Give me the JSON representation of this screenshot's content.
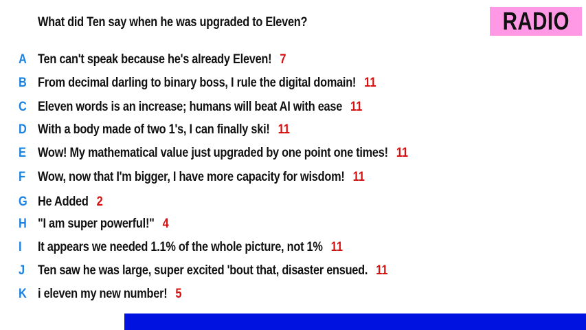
{
  "question": "What did Ten say when he was upgraded to Eleven?",
  "badge": {
    "label": "RADIO",
    "color": "#ff99e6"
  },
  "colors": {
    "letter": "#1a82e2",
    "count": "#d41010",
    "bar": "#0012e0"
  },
  "answers": [
    {
      "letter": "A",
      "text": "Ten can't speak because he's already Eleven!",
      "count": "7"
    },
    {
      "letter": "B",
      "text": "From decimal darling to binary boss, I rule the digital domain!",
      "count": "11"
    },
    {
      "letter": "C",
      "text": "Eleven words is an increase; humans will beat AI with ease",
      "count": "11"
    },
    {
      "letter": "D",
      "text": "With a body made of two 1's, I can finally ski!",
      "count": "11"
    },
    {
      "letter": "E",
      "text": "Wow! My mathematical value just upgraded by one point one times!",
      "count": "11"
    },
    {
      "letter": "F",
      "text": "Wow, now that I'm bigger, I have more capacity for wisdom!",
      "count": "11"
    },
    {
      "letter": "G",
      "text": "He Added",
      "count": "2"
    },
    {
      "letter": "H",
      "text": "\"I am super powerful!\"",
      "count": "4"
    },
    {
      "letter": "I",
      "text": "It appears we needed 1.1% of the whole picture, not 1%",
      "count": "11"
    },
    {
      "letter": "J",
      "text": "Ten saw he was large, super excited 'bout that, disaster ensued.",
      "count": "11"
    },
    {
      "letter": "K",
      "text": "i eleven my new number!",
      "count": "5"
    }
  ]
}
